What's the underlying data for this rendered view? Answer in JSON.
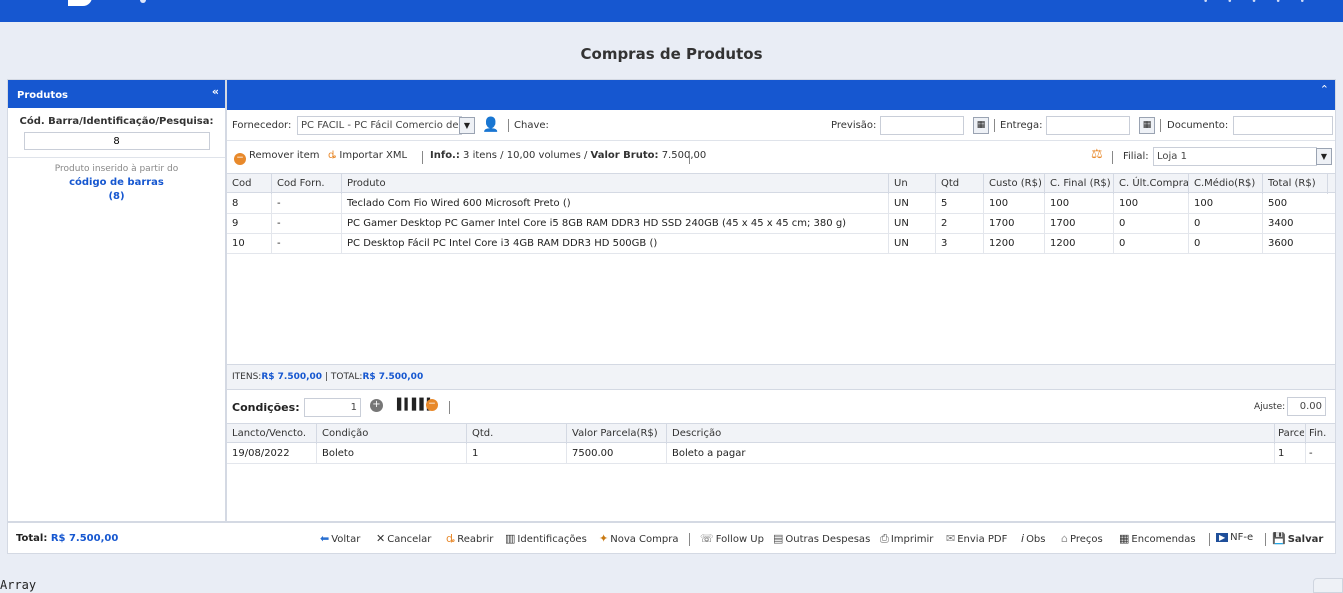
{
  "page_title": "Compras de Produtos",
  "left": {
    "header": "Produtos",
    "collapse": "«",
    "search_label": "Cód. Barra/Identificação/Pesquisa:",
    "search_value": "8",
    "info_line1": "Produto inserido à partir do",
    "info_line2": "código de barras",
    "info_line3": "(8)"
  },
  "main": {
    "collapse": "⌃",
    "fornecedor_label": "Fornecedor:",
    "fornecedor_value": "PC FACIL - PC Fácil Comercio de",
    "chave_label": "Chave:",
    "previsao_label": "Previsão:",
    "entrega_label": "Entrega:",
    "documento_label": "Documento:",
    "remover_item": "Remover item",
    "importar_xml": "Importar XML",
    "info_label": "Info.:",
    "info_text": "3 itens / 10,00 volumes /",
    "valor_bruto_label": "Valor Bruto:",
    "valor_bruto": "7.500,00",
    "filial_label": "Filial:",
    "filial_value": "Loja 1"
  },
  "grid": {
    "headers": [
      "Cod",
      "Cod Forn.",
      "Produto",
      "Un",
      "Qtd",
      "Custo (R$)",
      "C. Final (R$)",
      "C. Últ.Compra",
      "C.Médio(R$)",
      "Total (R$)"
    ],
    "rows": [
      [
        "8",
        "-",
        "Teclado Com Fio Wired 600 Microsoft Preto ()",
        "UN",
        "5",
        "100",
        "100",
        "100",
        "100",
        "500"
      ],
      [
        "9",
        "-",
        "PC Gamer Desktop PC Gamer Intel Core i5 8GB RAM DDR3 HD SSD 240GB (45 x 45 x 45 cm; 380 g)",
        "UN",
        "2",
        "1700",
        "1700",
        "0",
        "0",
        "3400"
      ],
      [
        "10",
        "-",
        "PC Desktop Fácil PC Intel Core i3 4GB RAM DDR3 HD 500GB ()",
        "UN",
        "3",
        "1200",
        "1200",
        "0",
        "0",
        "3600"
      ]
    ]
  },
  "totals": {
    "itens_label": "ITENS:",
    "itens_value": "R$ 7.500,00",
    "sep": "|",
    "total_label": "TOTAL:",
    "total_value": "R$ 7.500,00"
  },
  "conditions": {
    "label": "Condições:",
    "value": "1",
    "ajuste_label": "Ajuste:",
    "ajuste_value": "0.00",
    "headers": [
      "Lancto/Vencto.",
      "Condição",
      "Qtd.",
      "Valor Parcela(R$)",
      "Descrição",
      "Parce",
      "Fin."
    ],
    "rows": [
      [
        "19/08/2022",
        "Boleto",
        "1",
        "7500.00",
        "Boleto a pagar",
        "1",
        "-"
      ]
    ]
  },
  "footer": {
    "total_label": "Total:",
    "total_value": "R$ 7.500,00",
    "buttons": {
      "voltar": "Voltar",
      "cancelar": "Cancelar",
      "reabrir": "Reabrir",
      "identificacoes": "Identificações",
      "nova_compra": "Nova Compra",
      "follow_up": "Follow Up",
      "outras_despesas": "Outras Despesas",
      "imprimir": "Imprimir",
      "envia_pdf": "Envia PDF",
      "obs": "Obs",
      "precos": "Preços",
      "encomendas": "Encomendas",
      "nfe": "NF-e",
      "salvar": "Salvar"
    }
  },
  "debug_text": "Array"
}
